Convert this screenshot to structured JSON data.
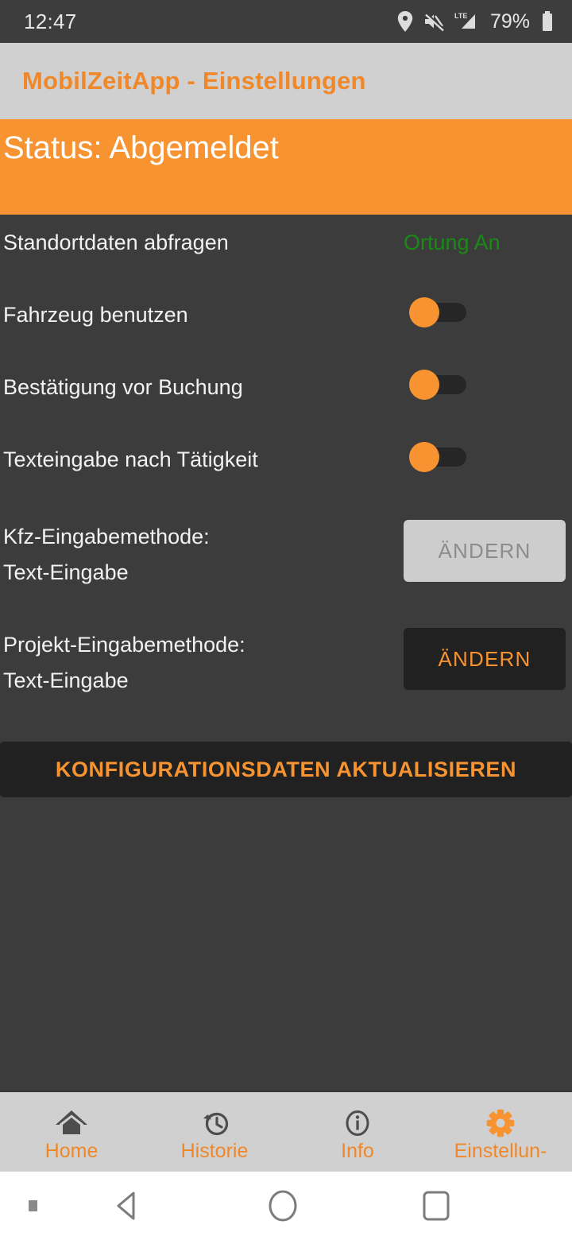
{
  "statusbar": {
    "clock": "12:47",
    "battery_percent": "79%",
    "icons": [
      "location-pin-icon",
      "mute-icon",
      "lte-signal-icon",
      "battery-icon"
    ]
  },
  "appbar": {
    "title": "MobilZeitApp - Einstellungen"
  },
  "banner": {
    "status_text": "Status: Abgemeldet",
    "background_color": "#f79331",
    "text_color": "#ffffff"
  },
  "settings": {
    "rows": [
      {
        "label": "Standortdaten abfragen",
        "control": "text",
        "value": "Ortung An",
        "value_color": "#1a8a16"
      },
      {
        "label": "Fahrzeug benutzen",
        "control": "switch",
        "value": "on"
      },
      {
        "label": "Bestätigung vor Buchung",
        "control": "switch",
        "value": "on"
      },
      {
        "label": "Texteingabe nach Tätigkeit",
        "control": "switch",
        "value": "on"
      }
    ],
    "kfz": {
      "label": "Kfz-Eingabemethode:",
      "value": "Text-Eingabe",
      "button_label": "ÄNDERN",
      "button_state": "disabled"
    },
    "projekt": {
      "label": "Projekt-Eingabemethode:",
      "value": "Text-Eingabe",
      "button_label": "ÄNDERN",
      "button_state": "enabled"
    },
    "update_button_label": "KONFIGURATIONSDATEN AKTUALISIEREN"
  },
  "bottomnav": {
    "items": [
      {
        "label": "Home",
        "icon": "home-icon",
        "active": false
      },
      {
        "label": "Historie",
        "icon": "history-icon",
        "active": false
      },
      {
        "label": "Info",
        "icon": "info-icon",
        "active": false
      },
      {
        "label": "Einstellun-",
        "icon": "gear-icon",
        "active": true
      }
    ],
    "active_color": "#f79331",
    "inactive_icon_color": "#4d4d4d",
    "label_color": "#f0882a"
  },
  "androidnav": {
    "buttons": [
      "back-button",
      "home-button",
      "recents-button"
    ]
  }
}
